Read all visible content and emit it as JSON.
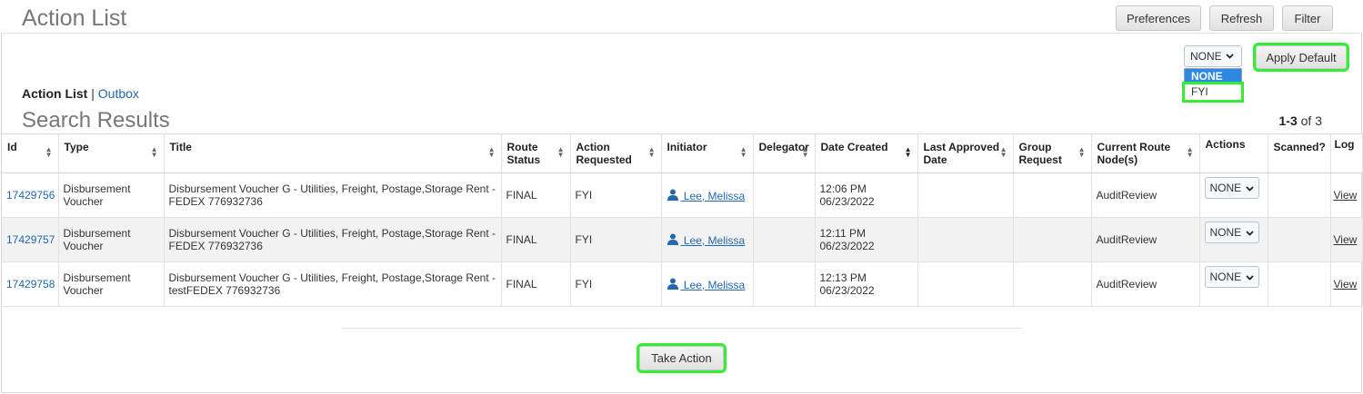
{
  "header": {
    "title": "Action List",
    "preferences_label": "Preferences",
    "refresh_label": "Refresh",
    "filter_label": "Filter"
  },
  "default_action": {
    "selected": "NONE",
    "options": [
      "NONE",
      "FYI"
    ],
    "apply_label": "Apply Default"
  },
  "tabs": {
    "active": "Action List",
    "separator": "|",
    "outbox": "Outbox"
  },
  "results": {
    "title": "Search Results",
    "range": "1-3",
    "of_text": "of 3"
  },
  "table": {
    "columns": [
      "Id",
      "Type",
      "Title",
      "Route Status",
      "Action Requested",
      "Initiator",
      "Delegator",
      "Date Created",
      "Last Approved Date",
      "Group Request",
      "Current Route Node(s)",
      "Actions",
      "Scanned?",
      "Log"
    ],
    "rows": [
      {
        "id": "17429756",
        "type": "Disbursement Voucher",
        "title": "Disbursement Voucher G - Utilities, Freight, Postage,Storage Rent - FEDEX 776932736",
        "route_status": "FINAL",
        "action_requested": "FYI",
        "initiator": "Lee, Melissa",
        "delegator": "",
        "date_time": "12:06 PM",
        "date": "06/23/2022",
        "last_approved": "",
        "group_request": "",
        "route_node": "AuditReview",
        "action": "NONE",
        "scanned": "",
        "log": "View"
      },
      {
        "id": "17429757",
        "type": "Disbursement Voucher",
        "title": "Disbursement Voucher G - Utilities, Freight, Postage,Storage Rent - FEDEX 776932736",
        "route_status": "FINAL",
        "action_requested": "FYI",
        "initiator": "Lee, Melissa",
        "delegator": "",
        "date_time": "12:11 PM",
        "date": "06/23/2022",
        "last_approved": "",
        "group_request": "",
        "route_node": "AuditReview",
        "action": "NONE",
        "scanned": "",
        "log": "View"
      },
      {
        "id": "17429758",
        "type": "Disbursement Voucher",
        "title": "Disbursement Voucher G - Utilities, Freight, Postage,Storage Rent - testFEDEX 776932736",
        "route_status": "FINAL",
        "action_requested": "FYI",
        "initiator": "Lee, Melissa",
        "delegator": "",
        "date_time": "12:13 PM",
        "date": "06/23/2022",
        "last_approved": "",
        "group_request": "",
        "route_node": "AuditReview",
        "action": "NONE",
        "scanned": "",
        "log": "View"
      }
    ]
  },
  "footer": {
    "take_action_label": "Take Action"
  },
  "icons": {
    "sort": "sort-icon",
    "person": "person-icon",
    "chevron": "chevron-down-icon"
  },
  "colors": {
    "link": "#2466b0",
    "highlight": "#33ee33",
    "selected_option": "#2d88e3"
  }
}
